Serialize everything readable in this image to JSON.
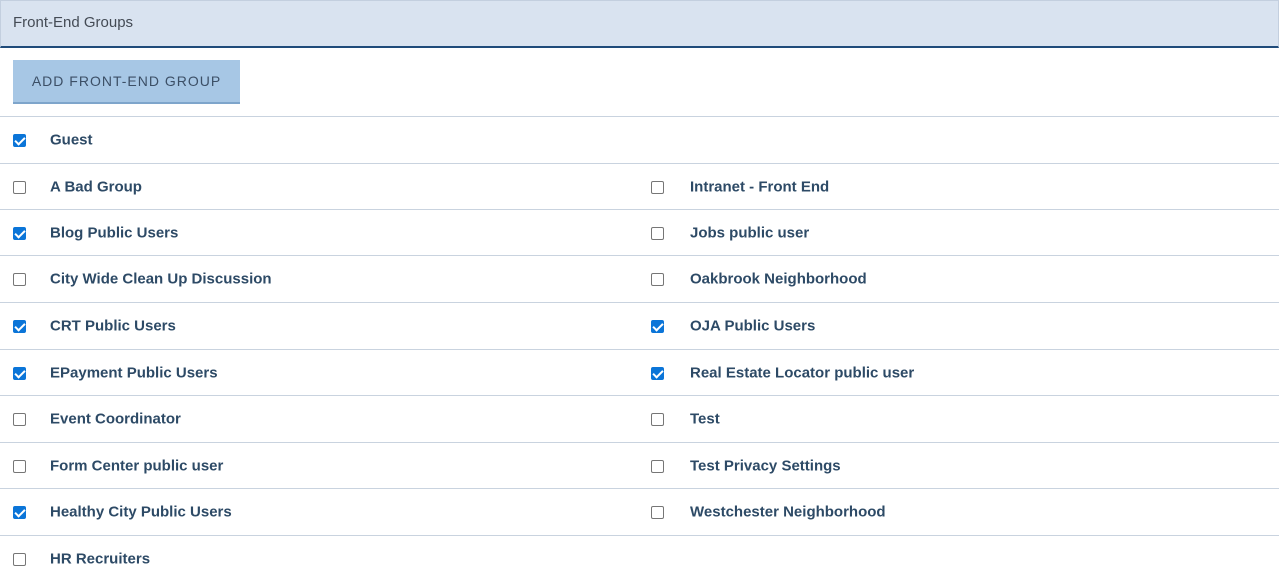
{
  "header": {
    "title": "Front-End Groups"
  },
  "toolbar": {
    "add_label": "ADD FRONT-END GROUP"
  },
  "guest": {
    "label": "Guest",
    "checked": true
  },
  "groups_left": [
    {
      "label": "A Bad Group",
      "checked": false
    },
    {
      "label": "Blog Public Users",
      "checked": true
    },
    {
      "label": "City Wide Clean Up Discussion",
      "checked": false
    },
    {
      "label": "CRT Public Users",
      "checked": true
    },
    {
      "label": "EPayment Public Users",
      "checked": true
    },
    {
      "label": "Event Coordinator",
      "checked": false
    },
    {
      "label": "Form Center public user",
      "checked": false
    },
    {
      "label": "Healthy City Public Users",
      "checked": true
    },
    {
      "label": "HR Recruiters",
      "checked": false
    }
  ],
  "groups_right": [
    {
      "label": "Intranet - Front End",
      "checked": false
    },
    {
      "label": "Jobs public user",
      "checked": false
    },
    {
      "label": "Oakbrook Neighborhood",
      "checked": false
    },
    {
      "label": "OJA Public Users",
      "checked": true
    },
    {
      "label": "Real Estate Locator public user",
      "checked": true
    },
    {
      "label": "Test",
      "checked": false
    },
    {
      "label": "Test Privacy Settings",
      "checked": false
    },
    {
      "label": "Westchester Neighborhood",
      "checked": false
    }
  ],
  "colors": {
    "accent": "#0b75d8",
    "header_bg": "#d9e3f0",
    "button_bg": "#a7c7e5",
    "label_text": "#2d4a66"
  }
}
